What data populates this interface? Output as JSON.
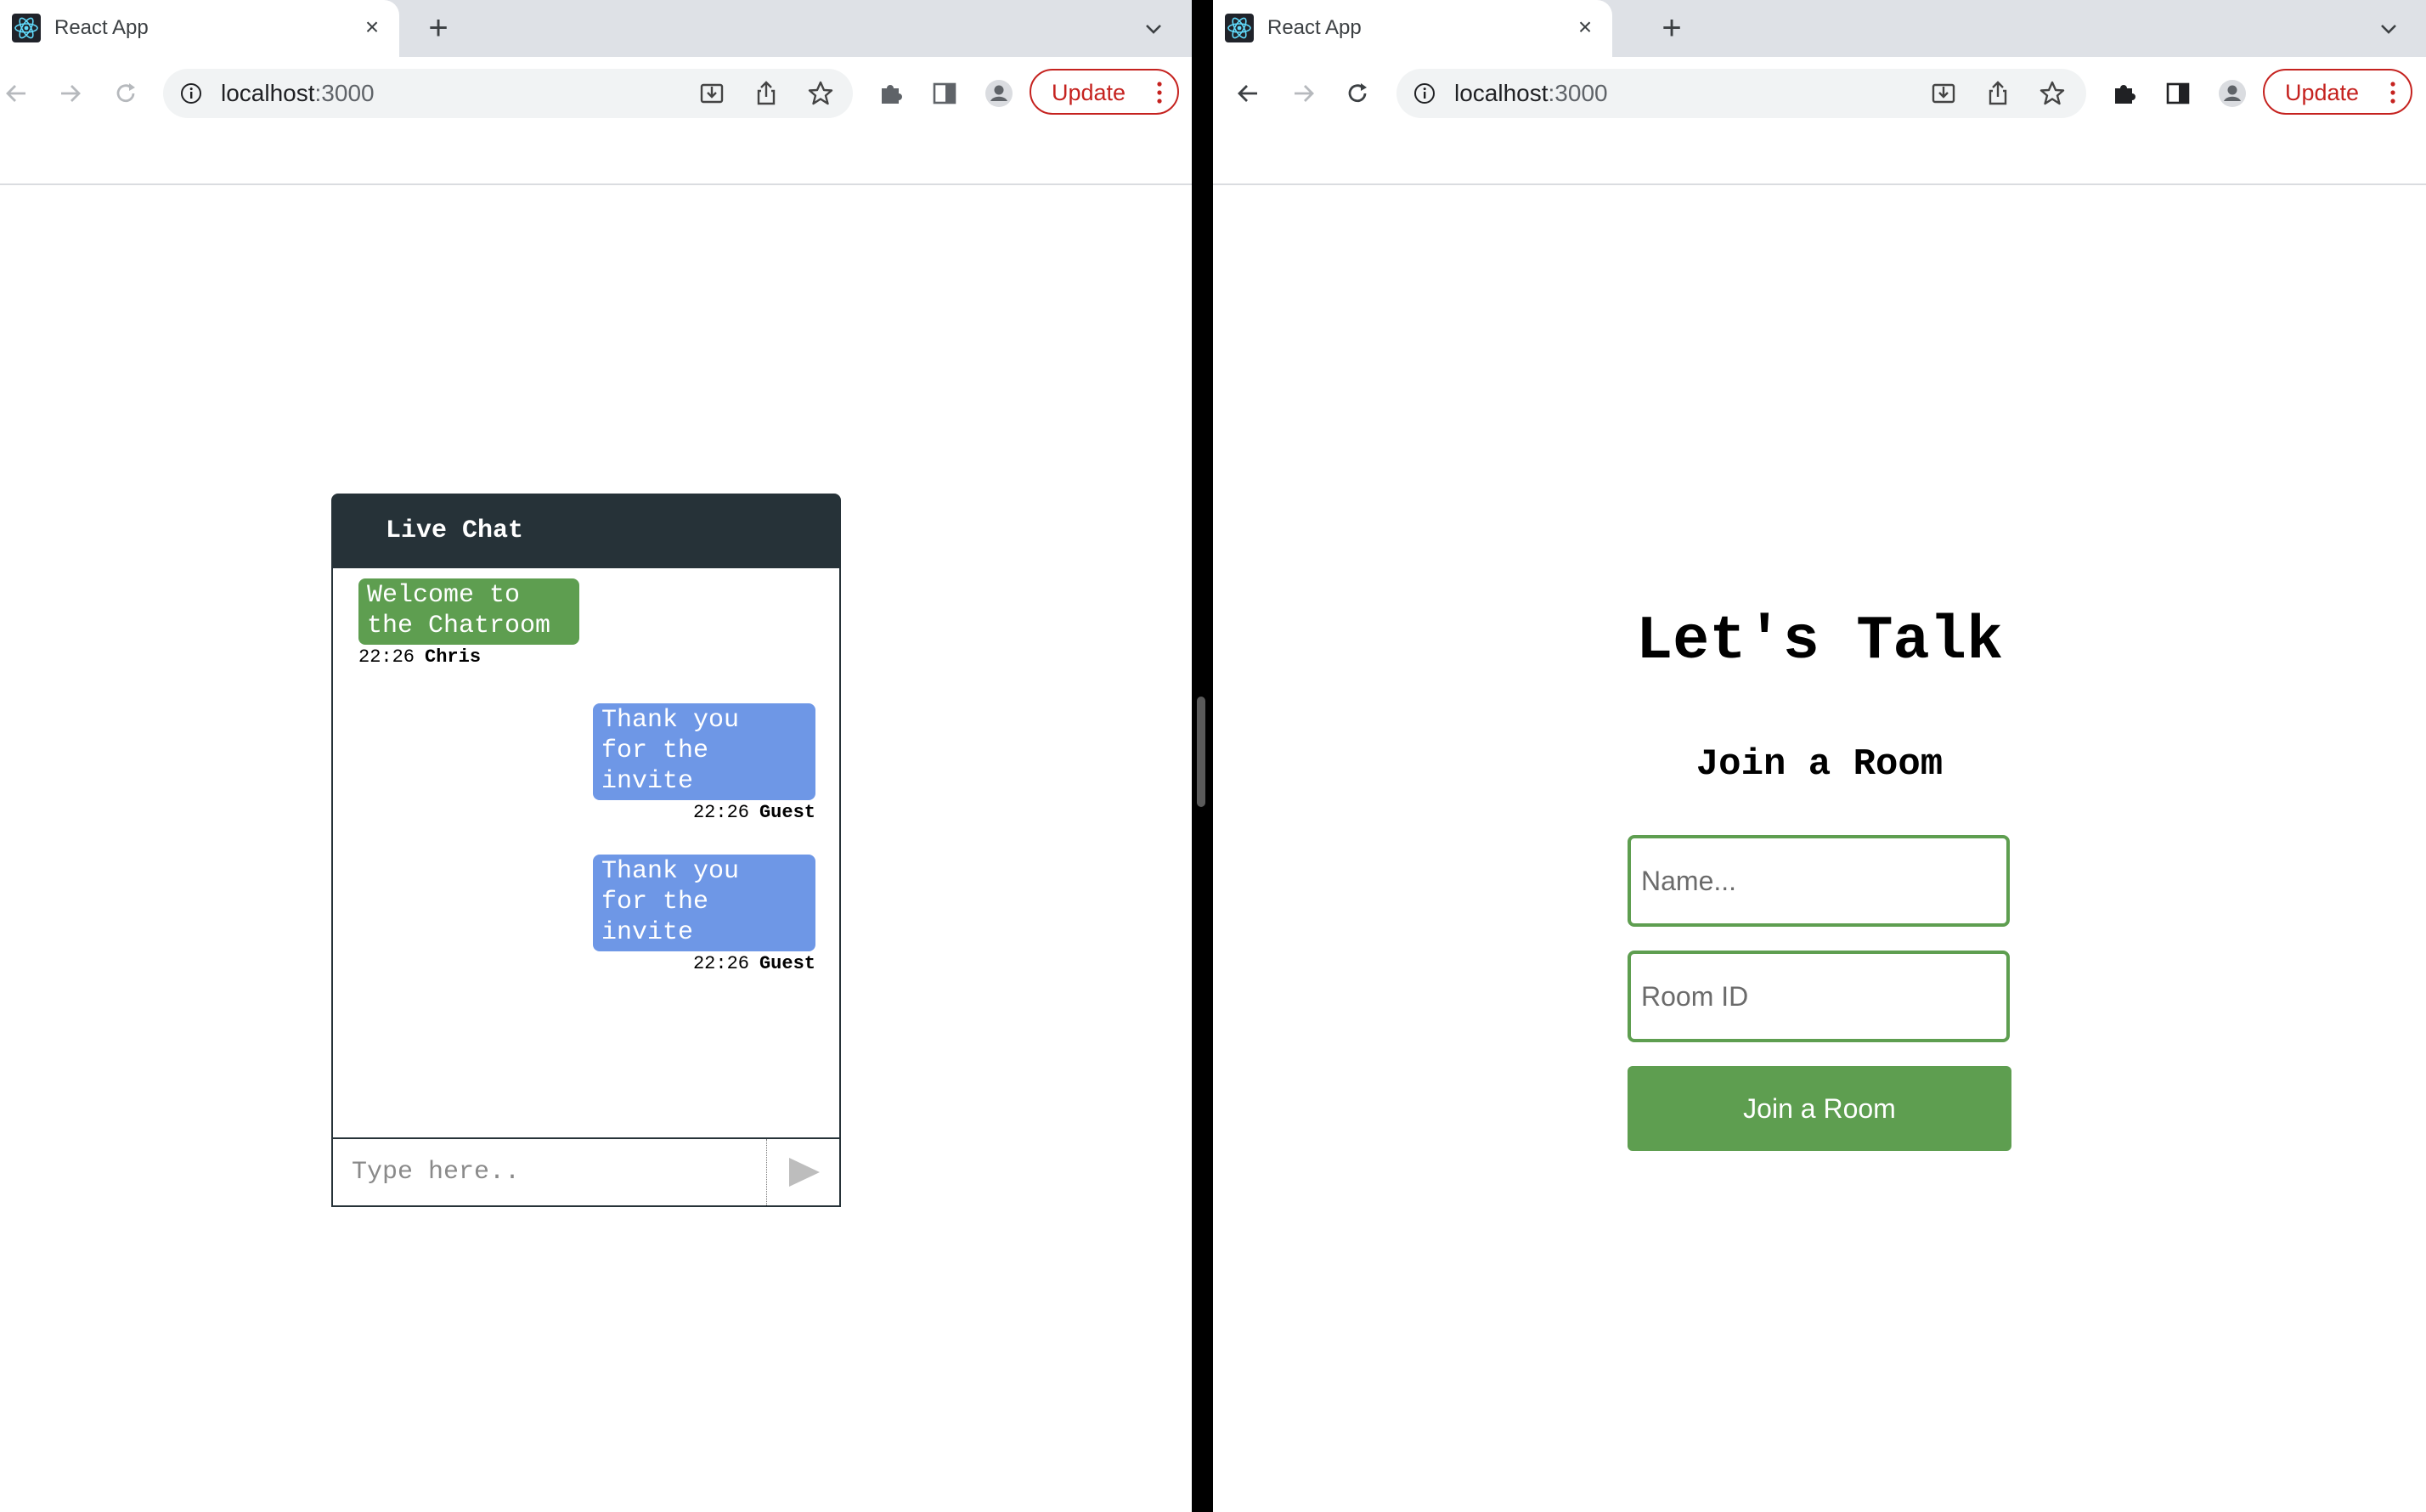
{
  "left_window": {
    "tab": {
      "title": "React App",
      "favicon": "react-icon"
    },
    "toolbar": {
      "url_host": "localhost",
      "url_port": ":3000",
      "update_label": "Update"
    },
    "chat": {
      "header": "Live Chat",
      "messages": [
        {
          "text_line1": "Welcome to",
          "text_line2": "the Chatroom",
          "time": "22:26",
          "author": "Chris",
          "side": "left",
          "color": "#5e9e50"
        },
        {
          "text_line1": "Thank you",
          "text_line2": "for the",
          "text_line3": "invite",
          "time": "22:26",
          "author": "Guest",
          "side": "right",
          "color": "#6e97e6"
        },
        {
          "text_line1": "Thank you",
          "text_line2": "for the",
          "text_line3": "invite",
          "time": "22:26",
          "author": "Guest",
          "side": "right",
          "color": "#6e97e6"
        }
      ],
      "input_placeholder": "Type here..",
      "send_icon": "send-icon"
    }
  },
  "right_window": {
    "tab": {
      "title": "React App",
      "favicon": "react-icon"
    },
    "toolbar": {
      "url_host": "localhost",
      "url_port": ":3000",
      "update_label": "Update"
    },
    "join": {
      "title": "Let's Talk",
      "subtitle": "Join a Room",
      "name_placeholder": "Name...",
      "room_placeholder": "Room ID",
      "button_label": "Join a Room"
    }
  },
  "colors": {
    "accent_green": "#5e9e50",
    "message_blue": "#6e97e6",
    "chat_header": "#263238",
    "update_red": "#c5221f"
  }
}
